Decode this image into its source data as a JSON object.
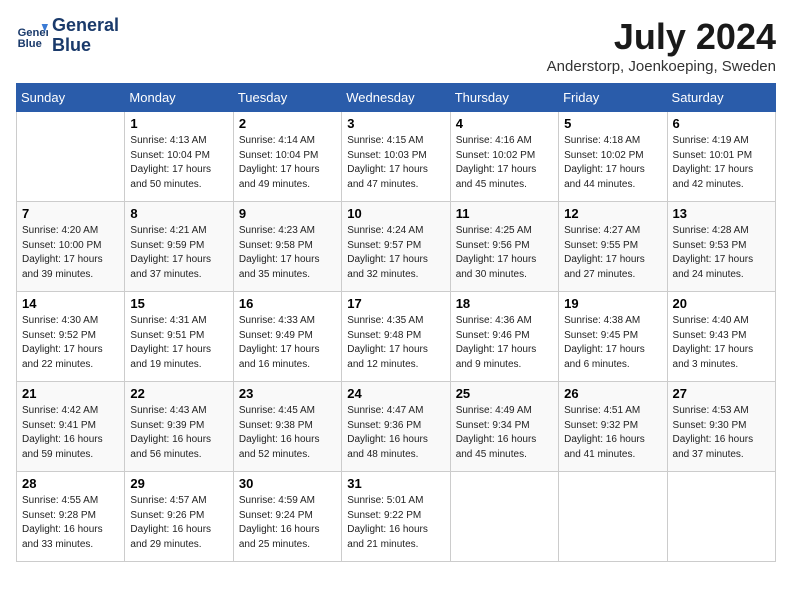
{
  "header": {
    "logo_line1": "General",
    "logo_line2": "Blue",
    "month": "July 2024",
    "location": "Anderstorp, Joenkoeping, Sweden"
  },
  "weekdays": [
    "Sunday",
    "Monday",
    "Tuesday",
    "Wednesday",
    "Thursday",
    "Friday",
    "Saturday"
  ],
  "weeks": [
    [
      {
        "day": "",
        "info": ""
      },
      {
        "day": "1",
        "info": "Sunrise: 4:13 AM\nSunset: 10:04 PM\nDaylight: 17 hours\nand 50 minutes."
      },
      {
        "day": "2",
        "info": "Sunrise: 4:14 AM\nSunset: 10:04 PM\nDaylight: 17 hours\nand 49 minutes."
      },
      {
        "day": "3",
        "info": "Sunrise: 4:15 AM\nSunset: 10:03 PM\nDaylight: 17 hours\nand 47 minutes."
      },
      {
        "day": "4",
        "info": "Sunrise: 4:16 AM\nSunset: 10:02 PM\nDaylight: 17 hours\nand 45 minutes."
      },
      {
        "day": "5",
        "info": "Sunrise: 4:18 AM\nSunset: 10:02 PM\nDaylight: 17 hours\nand 44 minutes."
      },
      {
        "day": "6",
        "info": "Sunrise: 4:19 AM\nSunset: 10:01 PM\nDaylight: 17 hours\nand 42 minutes."
      }
    ],
    [
      {
        "day": "7",
        "info": "Sunrise: 4:20 AM\nSunset: 10:00 PM\nDaylight: 17 hours\nand 39 minutes."
      },
      {
        "day": "8",
        "info": "Sunrise: 4:21 AM\nSunset: 9:59 PM\nDaylight: 17 hours\nand 37 minutes."
      },
      {
        "day": "9",
        "info": "Sunrise: 4:23 AM\nSunset: 9:58 PM\nDaylight: 17 hours\nand 35 minutes."
      },
      {
        "day": "10",
        "info": "Sunrise: 4:24 AM\nSunset: 9:57 PM\nDaylight: 17 hours\nand 32 minutes."
      },
      {
        "day": "11",
        "info": "Sunrise: 4:25 AM\nSunset: 9:56 PM\nDaylight: 17 hours\nand 30 minutes."
      },
      {
        "day": "12",
        "info": "Sunrise: 4:27 AM\nSunset: 9:55 PM\nDaylight: 17 hours\nand 27 minutes."
      },
      {
        "day": "13",
        "info": "Sunrise: 4:28 AM\nSunset: 9:53 PM\nDaylight: 17 hours\nand 24 minutes."
      }
    ],
    [
      {
        "day": "14",
        "info": "Sunrise: 4:30 AM\nSunset: 9:52 PM\nDaylight: 17 hours\nand 22 minutes."
      },
      {
        "day": "15",
        "info": "Sunrise: 4:31 AM\nSunset: 9:51 PM\nDaylight: 17 hours\nand 19 minutes."
      },
      {
        "day": "16",
        "info": "Sunrise: 4:33 AM\nSunset: 9:49 PM\nDaylight: 17 hours\nand 16 minutes."
      },
      {
        "day": "17",
        "info": "Sunrise: 4:35 AM\nSunset: 9:48 PM\nDaylight: 17 hours\nand 12 minutes."
      },
      {
        "day": "18",
        "info": "Sunrise: 4:36 AM\nSunset: 9:46 PM\nDaylight: 17 hours\nand 9 minutes."
      },
      {
        "day": "19",
        "info": "Sunrise: 4:38 AM\nSunset: 9:45 PM\nDaylight: 17 hours\nand 6 minutes."
      },
      {
        "day": "20",
        "info": "Sunrise: 4:40 AM\nSunset: 9:43 PM\nDaylight: 17 hours\nand 3 minutes."
      }
    ],
    [
      {
        "day": "21",
        "info": "Sunrise: 4:42 AM\nSunset: 9:41 PM\nDaylight: 16 hours\nand 59 minutes."
      },
      {
        "day": "22",
        "info": "Sunrise: 4:43 AM\nSunset: 9:39 PM\nDaylight: 16 hours\nand 56 minutes."
      },
      {
        "day": "23",
        "info": "Sunrise: 4:45 AM\nSunset: 9:38 PM\nDaylight: 16 hours\nand 52 minutes."
      },
      {
        "day": "24",
        "info": "Sunrise: 4:47 AM\nSunset: 9:36 PM\nDaylight: 16 hours\nand 48 minutes."
      },
      {
        "day": "25",
        "info": "Sunrise: 4:49 AM\nSunset: 9:34 PM\nDaylight: 16 hours\nand 45 minutes."
      },
      {
        "day": "26",
        "info": "Sunrise: 4:51 AM\nSunset: 9:32 PM\nDaylight: 16 hours\nand 41 minutes."
      },
      {
        "day": "27",
        "info": "Sunrise: 4:53 AM\nSunset: 9:30 PM\nDaylight: 16 hours\nand 37 minutes."
      }
    ],
    [
      {
        "day": "28",
        "info": "Sunrise: 4:55 AM\nSunset: 9:28 PM\nDaylight: 16 hours\nand 33 minutes."
      },
      {
        "day": "29",
        "info": "Sunrise: 4:57 AM\nSunset: 9:26 PM\nDaylight: 16 hours\nand 29 minutes."
      },
      {
        "day": "30",
        "info": "Sunrise: 4:59 AM\nSunset: 9:24 PM\nDaylight: 16 hours\nand 25 minutes."
      },
      {
        "day": "31",
        "info": "Sunrise: 5:01 AM\nSunset: 9:22 PM\nDaylight: 16 hours\nand 21 minutes."
      },
      {
        "day": "",
        "info": ""
      },
      {
        "day": "",
        "info": ""
      },
      {
        "day": "",
        "info": ""
      }
    ]
  ]
}
